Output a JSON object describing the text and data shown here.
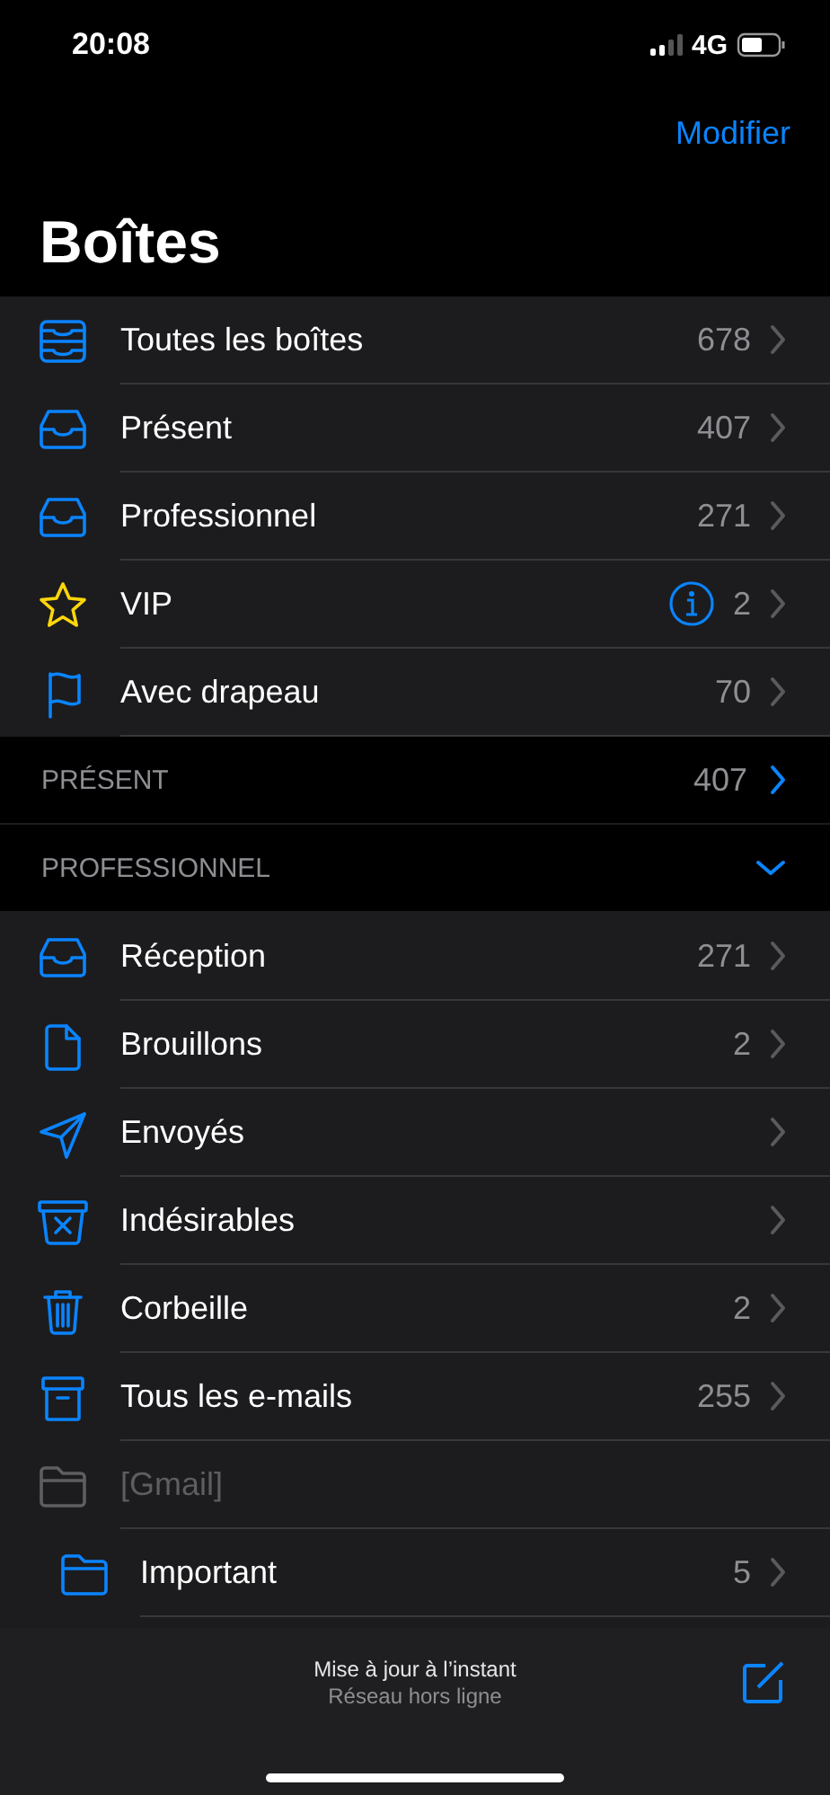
{
  "status_bar": {
    "time": "20:08",
    "network": "4G"
  },
  "nav": {
    "edit_button": "Modifier",
    "title": "Boîtes"
  },
  "mailboxes": [
    {
      "kind": "all-inboxes",
      "label": "Toutes les boîtes",
      "count": "678",
      "info": false
    },
    {
      "kind": "inbox",
      "label": "Présent",
      "count": "407",
      "info": false
    },
    {
      "kind": "inbox",
      "label": "Professionnel",
      "count": "271",
      "info": false
    },
    {
      "kind": "vip",
      "label": "VIP",
      "count": "2",
      "info": true
    },
    {
      "kind": "flagged",
      "label": "Avec drapeau",
      "count": "70",
      "info": false
    }
  ],
  "sections": [
    {
      "title": "PRÉSENT",
      "count": "407",
      "expanded": false
    },
    {
      "title": "PROFESSIONNEL",
      "expanded": true,
      "folders": [
        {
          "kind": "inbox",
          "label": "Réception",
          "count": "271",
          "disabled": false
        },
        {
          "kind": "drafts",
          "label": "Brouillons",
          "count": "2",
          "disabled": false
        },
        {
          "kind": "sent",
          "label": "Envoyés",
          "disabled": false
        },
        {
          "kind": "junk",
          "label": "Indésirables",
          "disabled": false
        },
        {
          "kind": "trash",
          "label": "Corbeille",
          "count": "2",
          "disabled": false
        },
        {
          "kind": "archive",
          "label": "Tous les e-mails",
          "count": "255",
          "disabled": false
        },
        {
          "kind": "folder",
          "label": "[Gmail]",
          "disabled": true,
          "children": [
            {
              "kind": "folder",
              "label": "Important",
              "count": "5",
              "disabled": false
            }
          ]
        }
      ]
    }
  ],
  "toolbar": {
    "status": "Mise à jour à l’instant",
    "substatus": "Réseau hors ligne"
  }
}
